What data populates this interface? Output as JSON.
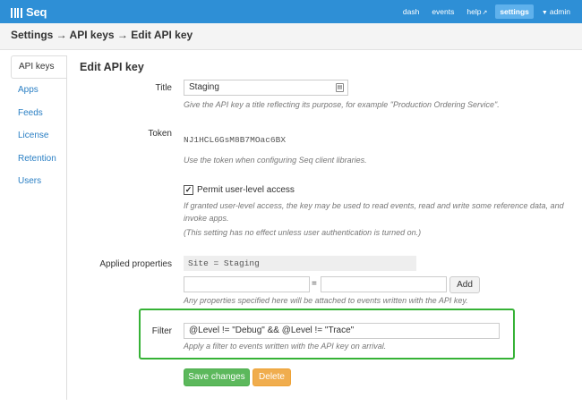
{
  "app": {
    "logo": "Seq"
  },
  "nav": {
    "dash": "dash",
    "events": "events",
    "help": "help",
    "settings": "settings",
    "admin": "admin"
  },
  "breadcrumb": "Settings → API keys → Edit API key",
  "sidebar": {
    "items": [
      {
        "label": "API keys",
        "active": true
      },
      {
        "label": "Apps"
      },
      {
        "label": "Feeds"
      },
      {
        "label": "License"
      },
      {
        "label": "Retention"
      },
      {
        "label": "Users"
      }
    ]
  },
  "form": {
    "heading": "Edit API key",
    "title": {
      "label": "Title",
      "value": "Staging",
      "help": "Give the API key a title reflecting its purpose, for example \"Production Ordering Service\"."
    },
    "token": {
      "label": "Token",
      "value": "NJ1HCL6GsM8B7MOac6BX",
      "help": "Use the token when configuring Seq client libraries."
    },
    "permit": {
      "checked": true,
      "label": "Permit user-level access",
      "help1": "If granted user-level access, the key may be used to read events, read and write some reference data, and invoke apps.",
      "help2": "(This setting has no effect unless user authentication is turned on.)"
    },
    "applied": {
      "label": "Applied properties",
      "existing": "Site = Staging",
      "name_value": "",
      "value_value": "",
      "equals": "=",
      "add_label": "Add",
      "help": "Any properties specified here will be attached to events written with the API key."
    },
    "filter": {
      "label": "Filter",
      "value": "@Level != \"Debug\" && @Level != \"Trace\"",
      "help": "Apply a filter to events written with the API key on arrival."
    },
    "save_label": "Save changes",
    "delete_label": "Delete"
  },
  "colors": {
    "topbar": "#2e8fd6",
    "link": "#2a7fc4",
    "highlight_border": "#36b236",
    "save": "#5cb85c",
    "delete": "#f0ad4e"
  }
}
